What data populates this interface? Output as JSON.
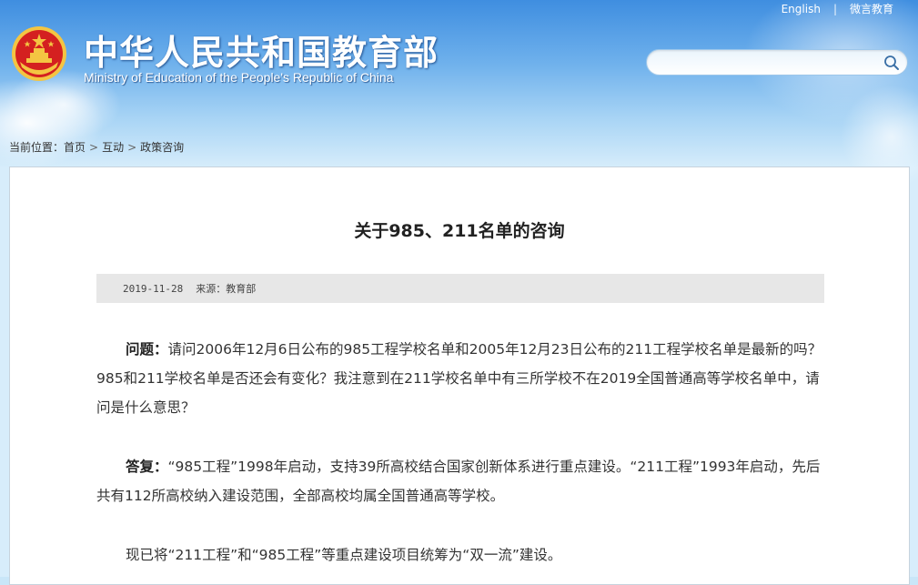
{
  "header": {
    "title": "中华人民共和国教育部",
    "subtitle": "Ministry of Education of the People's Republic of China",
    "links": [
      "English",
      "微言教育"
    ],
    "search": {
      "placeholder": "",
      "value": ""
    },
    "emblem_icon": "national-emblem-icon",
    "search_icon": "search-icon"
  },
  "breadcrumb": {
    "prefix": "当前位置：",
    "items": [
      "首页",
      "互动",
      "政策咨询"
    ],
    "separator": ">"
  },
  "article": {
    "title": "关于985、211名单的咨询",
    "date": "2019-11-28",
    "source": "来源：教育部",
    "question_label": "问题：",
    "question_text": "请问2006年12月6日公布的985工程学校名单和2005年12月23日公布的211工程学校名单是最新的吗？985和211学校名单是否还会有变化？我注意到在211学校名单中有三所学校不在2019全国普通高等学校名单中，请问是什么意思？",
    "answer_label": "答复：",
    "answer_text": "“985工程”1998年启动，支持39所高校结合国家创新体系进行重点建设。“211工程”1993年启动，先后共有112所高校纳入建设范围，全部高校均属全国普通高等学校。",
    "paragraph3": "现已将“211工程”和“985工程”等重点建设项目统筹为“双一流”建设。"
  },
  "colors": {
    "banner_top": "#3f8ee0",
    "banner_bottom": "#d7edfb",
    "meta_bar": "#e7e7e7",
    "emblem_red": "#d42020",
    "emblem_gold": "#f4c542"
  }
}
